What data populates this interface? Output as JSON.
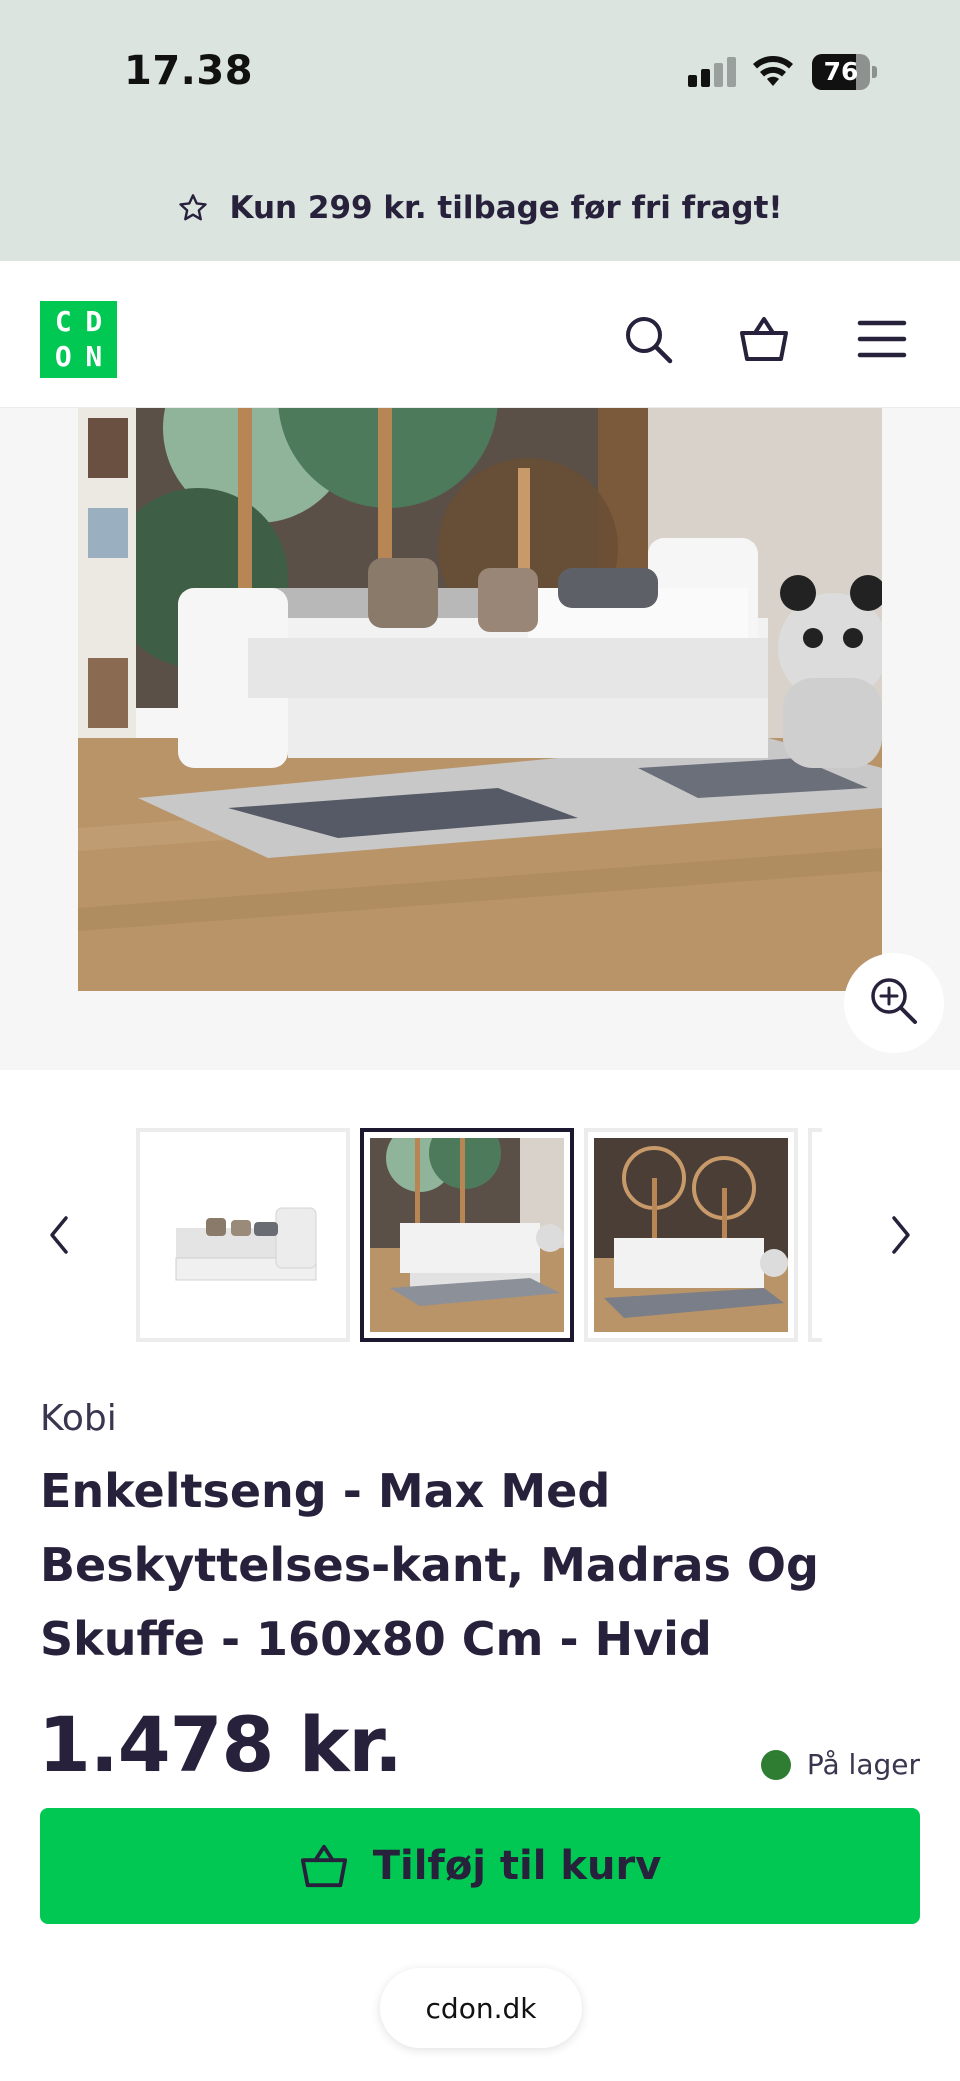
{
  "status_bar": {
    "time": "17.38",
    "battery": "76"
  },
  "promo": {
    "text": "Kun 299 kr. tilbage før fri fragt!",
    "icon": "star-outline-icon"
  },
  "header": {
    "logo_letters": [
      "C",
      "D",
      "O",
      "N"
    ],
    "icons": [
      "search-icon",
      "basket-icon",
      "menu-icon"
    ]
  },
  "gallery": {
    "zoom_icon": "zoom-in-icon",
    "prev_icon": "chevron-left-icon",
    "next_icon": "chevron-right-icon",
    "active_thumbnail": 2
  },
  "product": {
    "brand": "Kobi",
    "title": "Enkeltseng - Max Med Beskyttelses-kant, Madras Og Skuffe - 160x80 Cm - Hvid",
    "price": "1.478 kr.",
    "stock_label": "På lager",
    "stock_color": "#2e7d32"
  },
  "cta": {
    "add_to_cart_label": "Tilføj til kurv",
    "color": "#00c853"
  },
  "browser": {
    "url": "cdon.dk"
  }
}
